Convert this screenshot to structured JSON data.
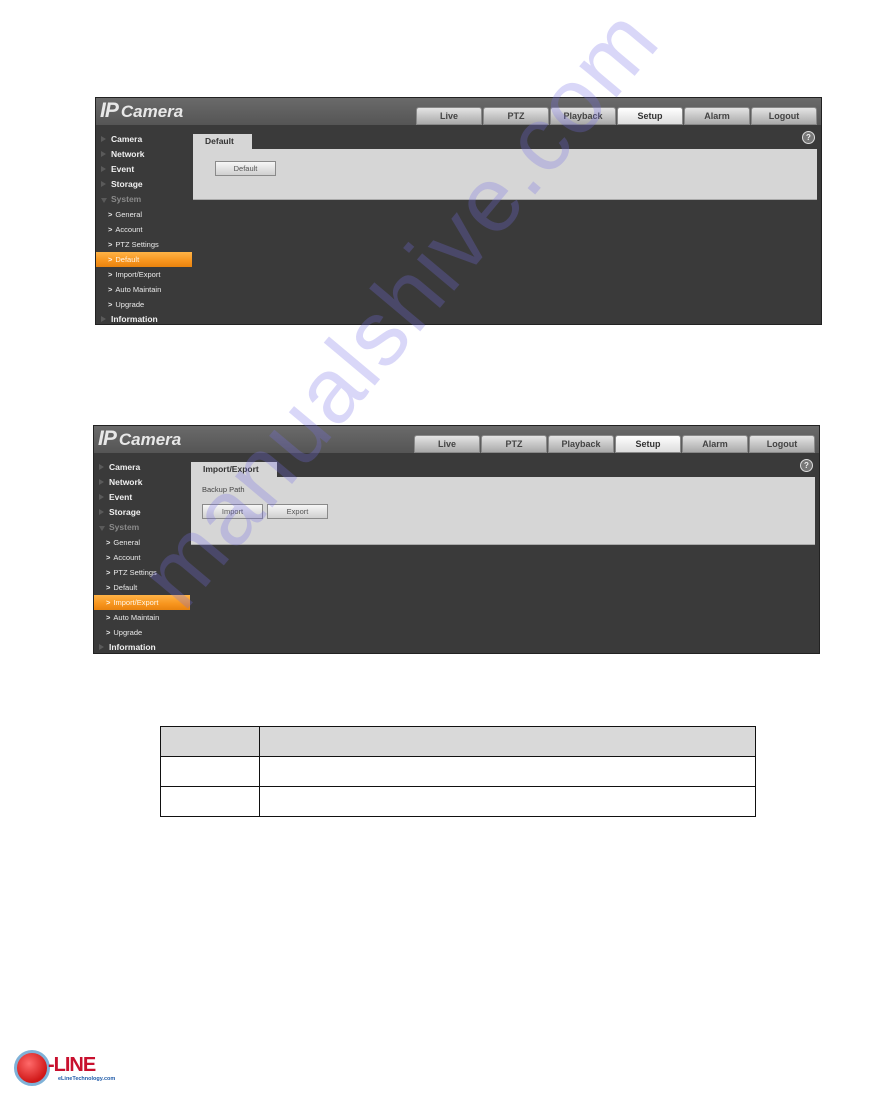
{
  "screenshots": [
    {
      "logo": {
        "ip": "IP",
        "camera": "Camera"
      },
      "nav_tabs": [
        {
          "label": "Live",
          "active": false
        },
        {
          "label": "PTZ",
          "active": false
        },
        {
          "label": "Playback",
          "active": false
        },
        {
          "label": "Setup",
          "active": true
        },
        {
          "label": "Alarm",
          "active": false
        },
        {
          "label": "Logout",
          "active": false
        }
      ],
      "sidebar": {
        "top_items": [
          "Camera",
          "Network",
          "Event",
          "Storage"
        ],
        "expanded_item": "System",
        "sub_items": [
          {
            "label": "General",
            "selected": false
          },
          {
            "label": "Account",
            "selected": false
          },
          {
            "label": "PTZ Settings",
            "selected": false
          },
          {
            "label": "Default",
            "selected": true
          },
          {
            "label": "Import/Export",
            "selected": false
          },
          {
            "label": "Auto Maintain",
            "selected": false
          },
          {
            "label": "Upgrade",
            "selected": false
          }
        ],
        "bottom_item": "Information"
      },
      "content": {
        "tab_label": "Default",
        "default_button": "Default",
        "help_icon": "?"
      }
    },
    {
      "logo": {
        "ip": "IP",
        "camera": "Camera"
      },
      "nav_tabs": [
        {
          "label": "Live",
          "active": false
        },
        {
          "label": "PTZ",
          "active": false
        },
        {
          "label": "Playback",
          "active": false
        },
        {
          "label": "Setup",
          "active": true
        },
        {
          "label": "Alarm",
          "active": false
        },
        {
          "label": "Logout",
          "active": false
        }
      ],
      "sidebar": {
        "top_items": [
          "Camera",
          "Network",
          "Event",
          "Storage"
        ],
        "expanded_item": "System",
        "sub_items": [
          {
            "label": "General",
            "selected": false
          },
          {
            "label": "Account",
            "selected": false
          },
          {
            "label": "PTZ Settings",
            "selected": false
          },
          {
            "label": "Default",
            "selected": false
          },
          {
            "label": "Import/Export",
            "selected": true
          },
          {
            "label": "Auto Maintain",
            "selected": false
          },
          {
            "label": "Upgrade",
            "selected": false
          }
        ],
        "bottom_item": "Information"
      },
      "content": {
        "tab_label": "Import/Export",
        "backup_path_label": "Backup Path",
        "import_button": "Import",
        "export_button": "Export",
        "help_icon": "?"
      }
    }
  ],
  "doc_table": {
    "rows": [
      [
        "",
        ""
      ],
      [
        "",
        ""
      ],
      [
        "",
        ""
      ]
    ]
  },
  "watermark": "manualshive.com",
  "brand": {
    "name": "-LINE",
    "url": "eLineTechnology.com"
  },
  "colors": {
    "selected_item": "#f7941d",
    "panel_bg": "#d6d6d6",
    "app_bg": "#3a3a3a",
    "brand_red": "#c8102e"
  }
}
